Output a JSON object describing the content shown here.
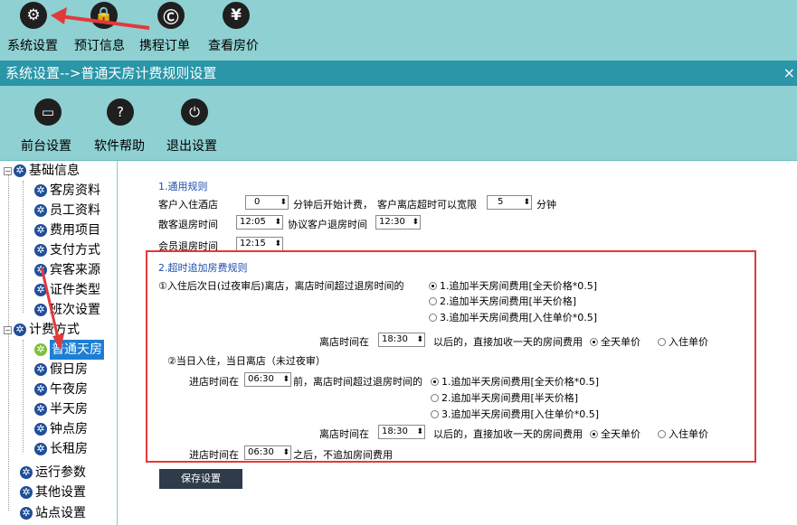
{
  "toolbar": {
    "items": [
      {
        "label": "系统设置",
        "icon": "gear-icon"
      },
      {
        "label": "预订信息",
        "icon": "lock-tag-icon"
      },
      {
        "label": "携程订单",
        "icon": "ctrip-icon"
      },
      {
        "label": "查看房价",
        "icon": "yen-search-icon"
      }
    ]
  },
  "title": "系统设置-->普通天房计费规则设置",
  "close_glyph": "×",
  "subtoolbar": {
    "items": [
      {
        "label": "前台设置",
        "icon": "monitor-icon"
      },
      {
        "label": "软件帮助",
        "icon": "help-icon"
      },
      {
        "label": "退出设置",
        "icon": "power-icon"
      }
    ]
  },
  "tree": {
    "groups": [
      {
        "label": "基础信息",
        "children": [
          "客房资料",
          "员工资料",
          "费用项目",
          "支付方式",
          "宾客来源",
          "证件类型",
          "班次设置"
        ]
      },
      {
        "label": "计费方式",
        "children": [
          "普通天房",
          "假日房",
          "午夜房",
          "半天房",
          "钟点房",
          "长租房"
        ]
      }
    ],
    "others": [
      "运行参数",
      "其他设置",
      "站点设置"
    ],
    "selected": "普通天房"
  },
  "general": {
    "heading": "1.通用规则",
    "checkin_prefix": "客户入住酒店",
    "checkin_minutes": "0",
    "checkin_suffix": "分钟后开始计费，",
    "leave_prefix": "客户离店超时可以宽限",
    "leave_minutes": "5",
    "leave_suffix": "分钟",
    "walkin_label": "散客退房时间",
    "walkin_time": "12:05",
    "agreement_label": "协议客户退房时间",
    "agreement_time": "12:30",
    "member_label": "会员退房时间",
    "member_time": "12:15"
  },
  "overtime": {
    "heading": "2.超时追加房费规则",
    "case1": {
      "text": "①入住后次日(过夜审后)离店，离店时间超过退房时间的",
      "options": [
        "1.追加半天房间费用[全天价格*0.5]",
        "2.追加半天房间费用[半天价格]",
        "3.追加半天房间费用[入住单价*0.5]"
      ],
      "selected": 0,
      "after_prefix": "离店时间在",
      "after_time": "18:30",
      "after_suffix": "以后的，直接加收一天的房间费用",
      "price_options": [
        "全天单价",
        "入住单价"
      ],
      "price_selected": 0
    },
    "case2": {
      "text": "②当日入住，当日离店（未过夜审）",
      "enter_prefix": "进店时间在",
      "enter_time": "06:30",
      "enter_suffix": "前，离店时间超过退房时间的",
      "options": [
        "1.追加半天房间费用[全天价格*0.5]",
        "2.追加半天房间费用[半天价格]",
        "3.追加半天房间费用[入住单价*0.5]"
      ],
      "selected": 0,
      "after_prefix": "离店时间在",
      "after_time": "18:30",
      "after_suffix": "以后的，直接加收一天的房间费用",
      "price_options": [
        "全天单价",
        "入住单价"
      ],
      "price_selected": 0,
      "final_prefix": "进店时间在",
      "final_time": "06:30",
      "final_suffix": "之后，不追加房间费用"
    }
  },
  "save_label": "保存设置",
  "colors": {
    "toolbar_bg": "#8fd0d2",
    "titlebar_bg": "#2a96a8",
    "highlight_box": "#e23a3a",
    "tree_icon": "#1f4e9a",
    "selection": "#1d7fd3"
  }
}
